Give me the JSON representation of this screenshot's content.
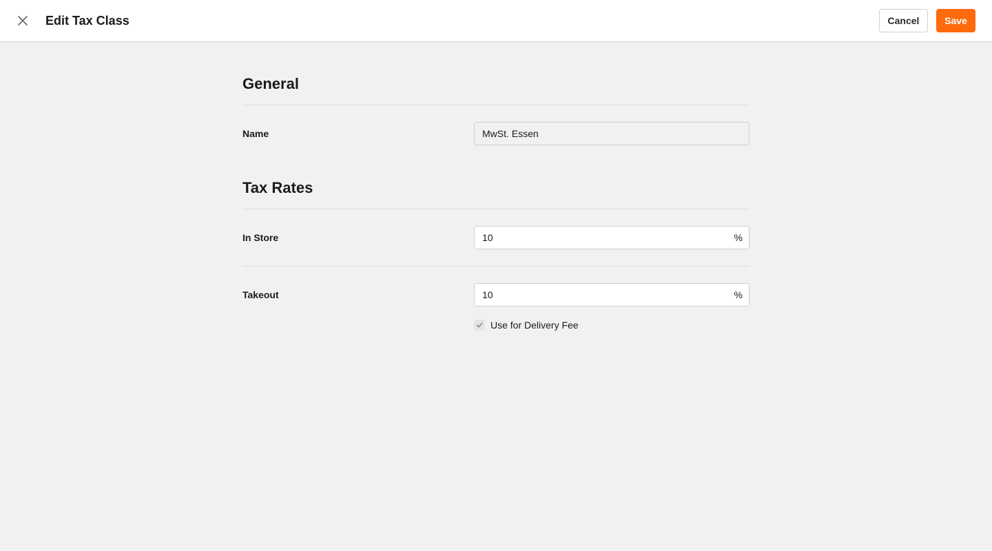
{
  "header": {
    "title": "Edit Tax Class",
    "cancel_label": "Cancel",
    "save_label": "Save",
    "accent_color": "#ff6a0d"
  },
  "general": {
    "section_title": "General",
    "name_label": "Name",
    "name_value": "MwSt. Essen"
  },
  "tax_rates": {
    "section_title": "Tax Rates",
    "in_store_label": "In Store",
    "in_store_value": "10",
    "in_store_suffix": "%",
    "takeout_label": "Takeout",
    "takeout_value": "10",
    "takeout_suffix": "%",
    "delivery_fee_label": "Use for Delivery Fee",
    "delivery_fee_checked": true
  }
}
